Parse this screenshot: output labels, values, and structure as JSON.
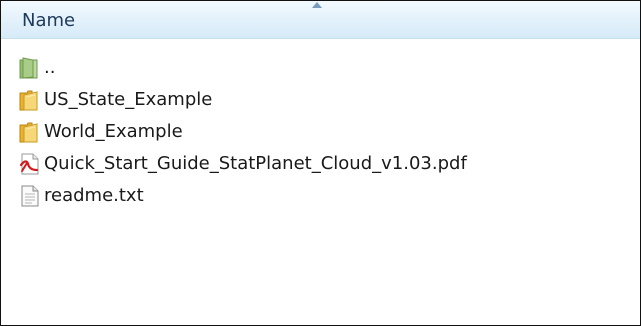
{
  "header": {
    "column_name": "Name",
    "sort_icon": "sort-ascending-icon"
  },
  "files": [
    {
      "name": "..",
      "icon": "parent-folder-icon"
    },
    {
      "name": "US_State_Example",
      "icon": "folder-icon"
    },
    {
      "name": "World_Example",
      "icon": "folder-icon"
    },
    {
      "name": "Quick_Start_Guide_StatPlanet_Cloud_v1.03.pdf",
      "icon": "pdf-file-icon"
    },
    {
      "name": "readme.txt",
      "icon": "text-file-icon"
    }
  ]
}
